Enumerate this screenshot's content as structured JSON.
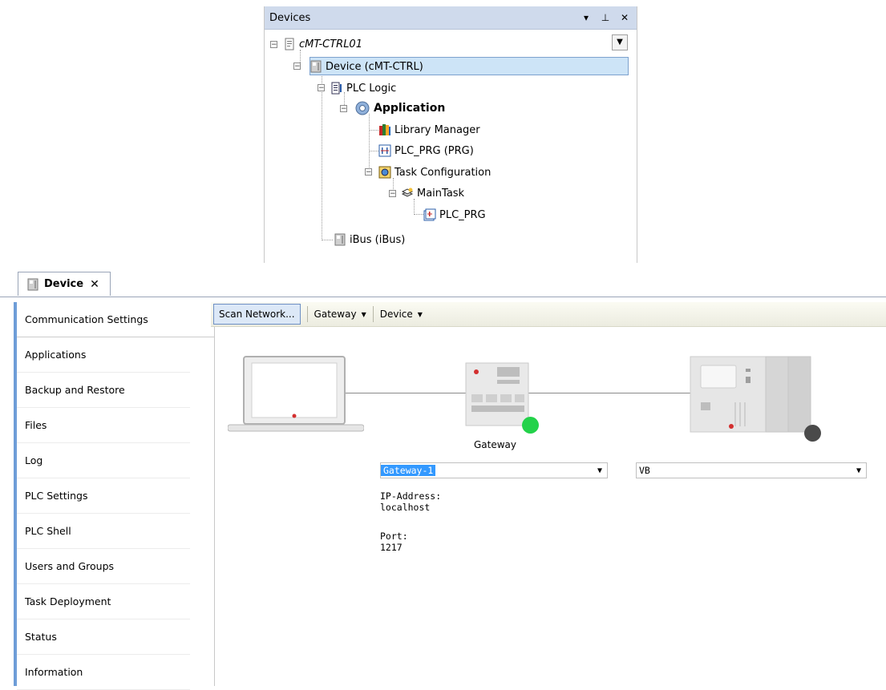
{
  "devices_panel": {
    "title": "Devices",
    "header_buttons": {
      "dropdown": "▾",
      "pin": "ᴘ",
      "close": "✕"
    },
    "tree": {
      "root": "cMT-CTRL01",
      "device": "Device (cMT-CTRL)",
      "plc_logic": "PLC Logic",
      "application": "Application",
      "library_manager": "Library Manager",
      "plc_prg_prg": "PLC_PRG (PRG)",
      "task_configuration": "Task Configuration",
      "main_task": "MainTask",
      "plc_prg": "PLC_PRG",
      "ibus": "iBus (iBus)"
    }
  },
  "editor_tab": {
    "label": "Device",
    "close": "✕"
  },
  "nav": {
    "items": [
      "Communication Settings",
      "Applications",
      "Backup and Restore",
      "Files",
      "Log",
      "PLC Settings",
      "PLC Shell",
      "Users and Groups",
      "Task Deployment",
      "Status",
      "Information"
    ],
    "active_index": 0
  },
  "toolbar": {
    "scan_label": "Scan Network...",
    "gateway_label": "Gateway",
    "device_label": "Device"
  },
  "network": {
    "gateway_caption": "Gateway",
    "gateway_combo": "Gateway-1",
    "device_combo": "VB",
    "ip_label": "IP-Address:",
    "ip_value": "localhost",
    "port_label": "Port:",
    "port_value": "1217",
    "gateway_status_color": "#23d24a",
    "device_status_color": "#4a4a4a"
  }
}
